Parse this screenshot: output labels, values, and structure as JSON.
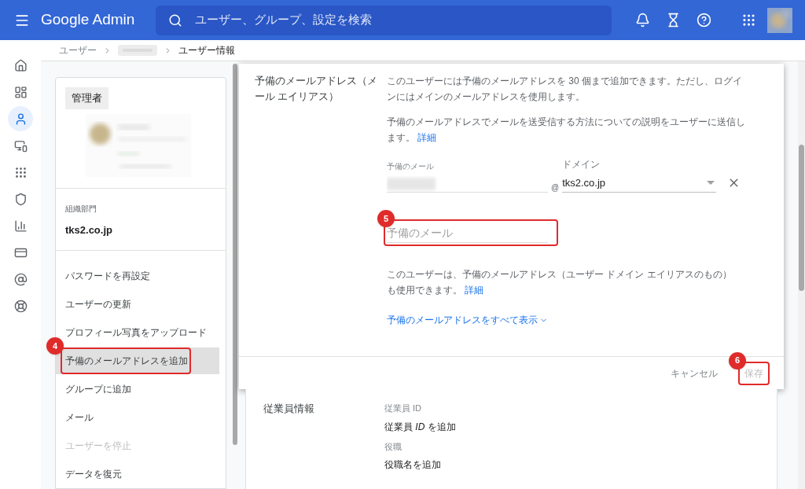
{
  "topbar": {
    "product": "Google Admin",
    "search": {
      "placeholder": "ユーザー、グループ、設定を検索"
    },
    "icons": [
      {
        "kind": "bell"
      },
      {
        "kind": "hourglass"
      },
      {
        "kind": "help"
      },
      {
        "kind": "apps"
      }
    ]
  },
  "rail": {
    "items": [
      {
        "kind": "home",
        "selected": false
      },
      {
        "kind": "dashboard",
        "selected": false
      },
      {
        "kind": "user",
        "selected": true
      },
      {
        "kind": "devices",
        "selected": false
      },
      {
        "kind": "apps",
        "selected": false
      },
      {
        "kind": "security",
        "selected": false
      },
      {
        "kind": "reports",
        "selected": false
      },
      {
        "kind": "billing",
        "selected": false
      },
      {
        "kind": "domain",
        "selected": false
      },
      {
        "kind": "support",
        "selected": false
      }
    ]
  },
  "breadcrumb": [
    {
      "kind": "link",
      "label": "ユーザー"
    },
    {
      "kind": "blurred"
    },
    {
      "kind": "current",
      "label": "ユーザー情報"
    }
  ],
  "user_card": {
    "role_badge": "管理者",
    "org_unit": {
      "label": "組織部門",
      "value": "tks2.co.jp"
    },
    "actions": [
      {
        "label": "パスワードを再設定",
        "selected": false,
        "disabled": false
      },
      {
        "label": "ユーザーの更新",
        "selected": false,
        "disabled": false
      },
      {
        "label": "プロフィール写真をアップロード",
        "selected": false,
        "disabled": false
      },
      {
        "label": "予備のメールアドレスを追加",
        "selected": true,
        "disabled": false
      },
      {
        "label": "グループに追加",
        "selected": false,
        "disabled": false
      },
      {
        "label": "メール",
        "selected": false,
        "disabled": false
      },
      {
        "label": "ユーザーを停止",
        "selected": false,
        "disabled": true
      },
      {
        "label": "データを復元",
        "selected": false,
        "disabled": false
      }
    ]
  },
  "dialog": {
    "section_title": "予備のメールアドレス（メール エイリアス）",
    "description": "このユーザーには予備のメールアドレスを 30 個まで追加できます。ただし、ログインにはメインのメールアドレスを使用します。",
    "help": {
      "text": "予備のメールアドレスでメールを送受信する方法についての説明をユーザーに送信します。",
      "link": "詳細"
    },
    "alias_row": {
      "email_label": "予備のメール",
      "at": "@",
      "domain_label": "ドメイン",
      "domain_value": "tks2.co.jp"
    },
    "new_alias": {
      "placeholder": "予備のメール"
    },
    "note": {
      "text": "このユーザーは、予備のメールアドレス（ユーザー ドメイン エイリアスのもの）も使用できます。",
      "link": "詳細"
    },
    "show_all": "予備のメールアドレスをすべて表示",
    "buttons": [
      {
        "label": "キャンセル",
        "disabled": false
      },
      {
        "label": "保存",
        "disabled": true
      }
    ]
  },
  "employee_info": {
    "title": "従業員情報",
    "fields": [
      {
        "label": "従業員 ID",
        "value": "従業員 *ID* を追加"
      },
      {
        "label": "役職",
        "value": "役職名を追加"
      }
    ]
  },
  "annotations": [
    {
      "label": "4"
    },
    {
      "label": "5"
    },
    {
      "label": "6"
    }
  ]
}
